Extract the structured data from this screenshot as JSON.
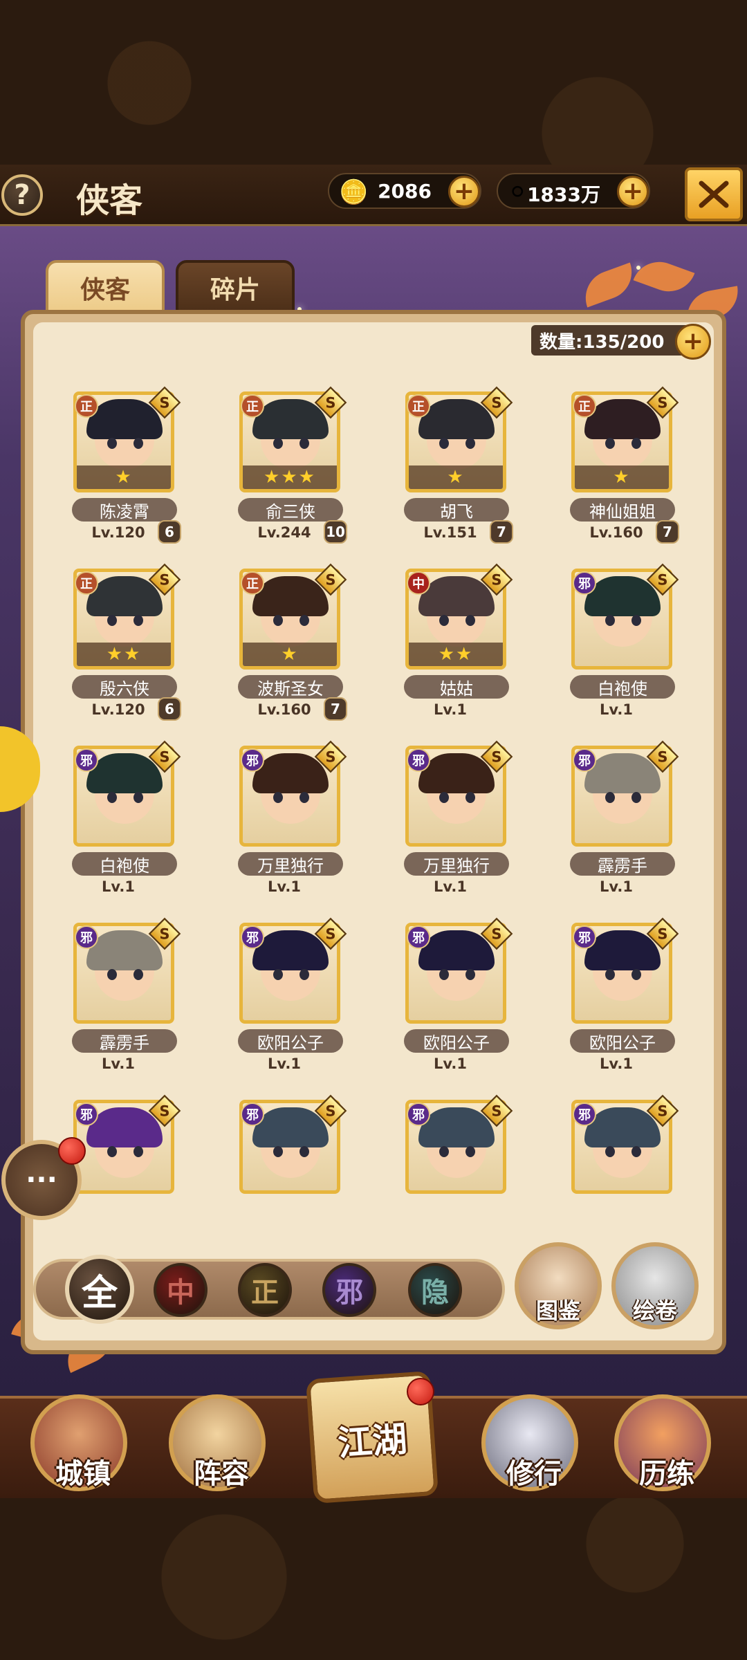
{
  "header": {
    "help_symbol": "?",
    "title": "侠客",
    "gold": "2086",
    "silver": "1833万"
  },
  "tabs": [
    {
      "label": "侠客",
      "active": true
    },
    {
      "label": "碎片",
      "active": false
    }
  ],
  "roster": {
    "count_label": "数量:135/200"
  },
  "heroes": [
    {
      "faction": "正",
      "faction_color": "#b5502a",
      "rank": "S",
      "stars": "★",
      "name": "陈凌霄",
      "level": "Lv.120",
      "grade": "6",
      "hair": "#20212e"
    },
    {
      "faction": "正",
      "faction_color": "#b5502a",
      "rank": "S",
      "stars": "★★★",
      "name": "俞三侠",
      "level": "Lv.244",
      "grade": "10",
      "hair": "#2a2f33"
    },
    {
      "faction": "正",
      "faction_color": "#b5502a",
      "rank": "S",
      "stars": "★",
      "name": "胡飞",
      "level": "Lv.151",
      "grade": "7",
      "hair": "#2a2a30"
    },
    {
      "faction": "正",
      "faction_color": "#b5502a",
      "rank": "S",
      "stars": "★",
      "name": "神仙姐姐",
      "level": "Lv.160",
      "grade": "7",
      "hair": "#2e1e22"
    },
    {
      "faction": "正",
      "faction_color": "#b5502a",
      "rank": "S",
      "stars": "★★",
      "name": "殷六侠",
      "level": "Lv.120",
      "grade": "6",
      "hair": "#2f3336"
    },
    {
      "faction": "正",
      "faction_color": "#b5502a",
      "rank": "S",
      "stars": "★",
      "name": "波斯圣女",
      "level": "Lv.160",
      "grade": "7",
      "hair": "#3a241a"
    },
    {
      "faction": "中",
      "faction_color": "#a8221c",
      "rank": "S",
      "stars": "★★",
      "name": "姑姑",
      "level": "Lv.1",
      "grade": "",
      "hair": "#4a3a3a"
    },
    {
      "faction": "邪",
      "faction_color": "#5a2a8a",
      "rank": "S",
      "stars": "",
      "name": "白袍使",
      "level": "Lv.1",
      "grade": "",
      "hair": "#1f3330"
    },
    {
      "faction": "邪",
      "faction_color": "#5a2a8a",
      "rank": "S",
      "stars": "",
      "name": "白袍使",
      "level": "Lv.1",
      "grade": "",
      "hair": "#1f3330"
    },
    {
      "faction": "邪",
      "faction_color": "#5a2a8a",
      "rank": "S",
      "stars": "",
      "name": "万里独行",
      "level": "Lv.1",
      "grade": "",
      "hair": "#3a2218"
    },
    {
      "faction": "邪",
      "faction_color": "#5a2a8a",
      "rank": "S",
      "stars": "",
      "name": "万里独行",
      "level": "Lv.1",
      "grade": "",
      "hair": "#3a2218"
    },
    {
      "faction": "邪",
      "faction_color": "#5a2a8a",
      "rank": "S",
      "stars": "",
      "name": "霹雳手",
      "level": "Lv.1",
      "grade": "",
      "hair": "#8a8478"
    },
    {
      "faction": "邪",
      "faction_color": "#5a2a8a",
      "rank": "S",
      "stars": "",
      "name": "霹雳手",
      "level": "Lv.1",
      "grade": "",
      "hair": "#8a8478"
    },
    {
      "faction": "邪",
      "faction_color": "#5a2a8a",
      "rank": "S",
      "stars": "",
      "name": "欧阳公子",
      "level": "Lv.1",
      "grade": "",
      "hair": "#1e1a3a"
    },
    {
      "faction": "邪",
      "faction_color": "#5a2a8a",
      "rank": "S",
      "stars": "",
      "name": "欧阳公子",
      "level": "Lv.1",
      "grade": "",
      "hair": "#1e1a3a"
    },
    {
      "faction": "邪",
      "faction_color": "#5a2a8a",
      "rank": "S",
      "stars": "",
      "name": "欧阳公子",
      "level": "Lv.1",
      "grade": "",
      "hair": "#1e1a3a"
    },
    {
      "faction": "邪",
      "faction_color": "#5a2a8a",
      "rank": "S",
      "stars": "",
      "name": "",
      "level": "",
      "grade": "",
      "hair": "#5a2a8a"
    },
    {
      "faction": "邪",
      "faction_color": "#5a2a8a",
      "rank": "S",
      "stars": "",
      "name": "",
      "level": "",
      "grade": "",
      "hair": "#3a4a5a"
    },
    {
      "faction": "邪",
      "faction_color": "#5a2a8a",
      "rank": "S",
      "stars": "",
      "name": "",
      "level": "",
      "grade": "",
      "hair": "#3a4a5a"
    },
    {
      "faction": "邪",
      "faction_color": "#5a2a8a",
      "rank": "S",
      "stars": "",
      "name": "",
      "level": "",
      "grade": "",
      "hair": "#3a4a5a"
    }
  ],
  "filters": [
    {
      "label": "全",
      "color": "#6a5240",
      "text_color": "#ffffff",
      "active": true
    },
    {
      "label": "中",
      "color": "#7a1c1a",
      "text_color": "#c8665a",
      "active": false
    },
    {
      "label": "正",
      "color": "#5a4a22",
      "text_color": "#c8a460",
      "active": false
    },
    {
      "label": "邪",
      "color": "#4a2a7a",
      "text_color": "#a88ad0",
      "active": false
    },
    {
      "label": "隐",
      "color": "#2a4a4a",
      "text_color": "#7ab0a8",
      "active": false
    }
  ],
  "side_buttons": {
    "handbook": "图鉴",
    "scroll": "绘卷"
  },
  "chat_symbol": "···",
  "bottom_nav": [
    {
      "label": "城镇",
      "color": "#8a3a2a"
    },
    {
      "label": "阵容",
      "color": "#a07040"
    },
    {
      "label": "江湖",
      "color": "#d8a860"
    },
    {
      "label": "修行",
      "color": "#6a6a7a"
    },
    {
      "label": "历练",
      "color": "#7a3a5a"
    }
  ]
}
